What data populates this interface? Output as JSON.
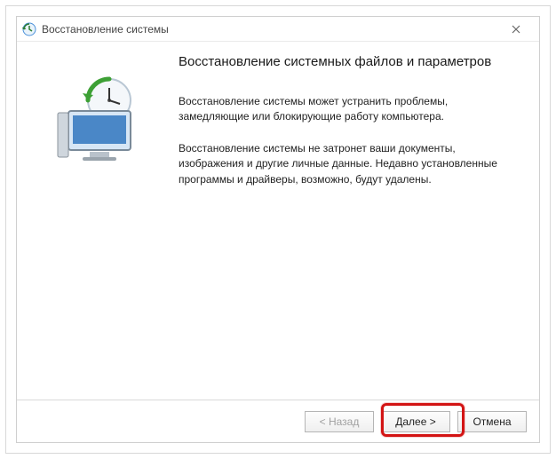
{
  "window": {
    "title": "Восстановление системы"
  },
  "main": {
    "heading": "Восстановление системных файлов и параметров",
    "paragraph1": "Восстановление системы может устранить проблемы, замедляющие или блокирующие работу компьютера.",
    "paragraph2": "Восстановление системы не затронет ваши документы, изображения и другие личные данные. Недавно установленные программы и драйверы, возможно, будут удалены."
  },
  "buttons": {
    "back": "< Назад",
    "next": "Далее >",
    "cancel": "Отмена"
  }
}
